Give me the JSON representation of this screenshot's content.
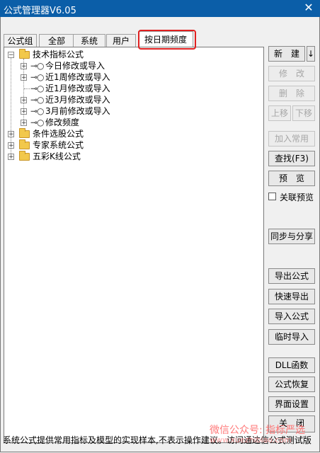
{
  "window": {
    "title": "公式管理器V6.05",
    "close_glyph": "✕"
  },
  "tabs": [
    {
      "label": "公式组"
    },
    {
      "label": "全部"
    },
    {
      "label": "系统"
    },
    {
      "label": "用户"
    },
    {
      "label": "按日期频度"
    }
  ],
  "active_tab": "按日期频度",
  "tree": {
    "nodes": [
      {
        "label": "技术指标公式",
        "expanded": true,
        "icon": "folder-icon"
      },
      {
        "label": "今日修改或导入",
        "icon": "key-icon"
      },
      {
        "label": "近1周修改或导入",
        "icon": "key-icon"
      },
      {
        "label": "近1月修改或导入",
        "icon": "key-icon"
      },
      {
        "label": "近3月修改或导入",
        "icon": "key-icon"
      },
      {
        "label": "3月前修改或导入",
        "icon": "key-icon"
      },
      {
        "label": "修改频度",
        "icon": "key-icon"
      },
      {
        "label": "条件选股公式",
        "icon": "folder-icon"
      },
      {
        "label": "专家系统公式",
        "icon": "folder-icon"
      },
      {
        "label": "五彩K线公式",
        "icon": "folder-icon"
      }
    ]
  },
  "buttons": {
    "new": "新　建",
    "new_arrow": "↓",
    "modify": "修　改",
    "delete": "删　除",
    "move_up": "上移",
    "move_down": "下移",
    "add_common": "加入常用",
    "find": "查找(F3)",
    "preview": "预　览",
    "sync_share": "同步与分享",
    "export": "导出公式",
    "quick_export": "快速导出",
    "import": "导入公式",
    "temp_import": "临时导入",
    "dll": "DLL函数",
    "restore": "公式恢复",
    "ui_settings": "界面设置",
    "close": "关　闭"
  },
  "checkbox": {
    "label": "关联预览",
    "checked": false
  },
  "status_bar": {
    "text": "系统公式提供常用指标及模型的实现样本,不表示操作建议。访问通达信公式测试版"
  },
  "watermark": {
    "line1": "微信公众号: 指标严选",
    "line2": "www.xuezhibiao.com"
  },
  "colors": {
    "titlebar": "#0b5ea8",
    "highlight": "#e02020",
    "watermark": "#ff6b6b"
  }
}
